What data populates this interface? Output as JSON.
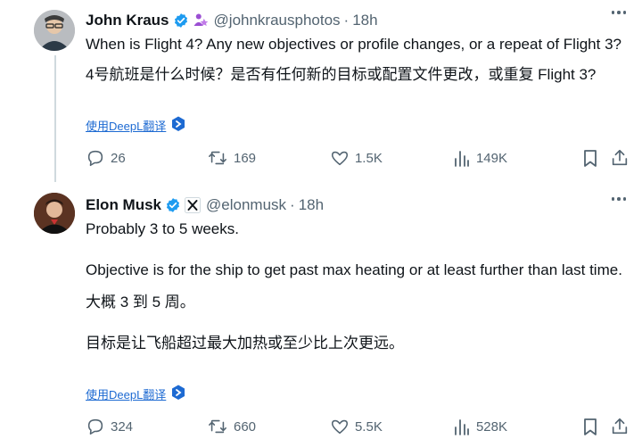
{
  "tweets": [
    {
      "name": "John Kraus",
      "handle": "@johnkrausphotos",
      "separator": "·",
      "time": "18h",
      "text_en": "When is Flight 4? Any new objectives or profile changes, or a repeat of Flight 3?",
      "text_zh": "4号航班是什么时候？是否有任何新的目标或配置文件更改，或重复 Flight 3?",
      "translate_label": "使用DeepL翻译",
      "stats": {
        "replies": "26",
        "retweets": "169",
        "likes": "1.5K",
        "views": "149K"
      }
    },
    {
      "name": "Elon Musk",
      "handle": "@elonmusk",
      "separator": "·",
      "time": "18h",
      "text_en_1": "Probably 3 to 5 weeks.",
      "text_en_2": "Objective is for the ship to get past max heating or at least further than last time.",
      "text_zh_1": "大概 3 到 5 周。",
      "text_zh_2": "目标是让飞船超过最大加热或至少比上次更远。",
      "translate_label": "使用DeepL翻译",
      "stats": {
        "replies": "324",
        "retweets": "660",
        "likes": "5.5K",
        "views": "528K"
      }
    }
  ],
  "colors": {
    "verified": "#1d9bf0",
    "affiliation": "#9b4fd3",
    "deepl": "#1d6ad2",
    "muted": "#536471"
  },
  "icons": [
    "verified-icon",
    "affiliation-icon",
    "x-logo-icon",
    "more-icon",
    "reply-icon",
    "retweet-icon",
    "like-icon",
    "views-icon",
    "bookmark-icon",
    "share-icon",
    "deepl-icon"
  ]
}
